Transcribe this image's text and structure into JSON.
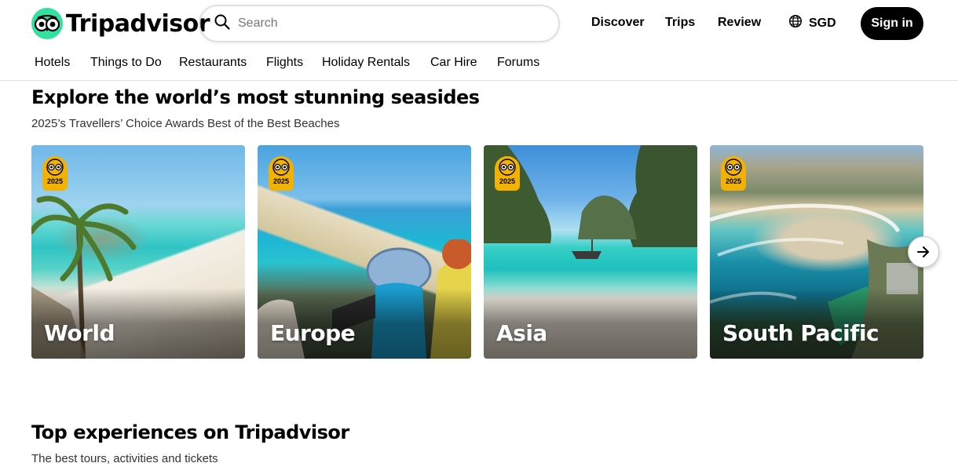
{
  "header": {
    "brand": "Tripadvisor",
    "search_placeholder": "Search",
    "nav": [
      "Discover",
      "Trips",
      "Review"
    ],
    "currency": "SGD",
    "signin_label": "Sign in",
    "brand_color": "#34e0a1"
  },
  "categories": [
    "Hotels",
    "Things to Do",
    "Restaurants",
    "Flights",
    "Holiday Rentals",
    "Car Hire",
    "Forums"
  ],
  "seasides": {
    "title": "Explore the world’s most stunning seasides",
    "subtitle": "2025’s Travellers’ Choice Awards Best of the Best Beaches",
    "badge_year": "2025",
    "cards": [
      {
        "label": "World"
      },
      {
        "label": "Europe"
      },
      {
        "label": "Asia"
      },
      {
        "label": "South Pacific"
      }
    ],
    "next_icon": "arrow-right-icon"
  },
  "experiences": {
    "title": "Top experiences on Tripadvisor",
    "subtitle": "The best tours, activities and tickets"
  }
}
